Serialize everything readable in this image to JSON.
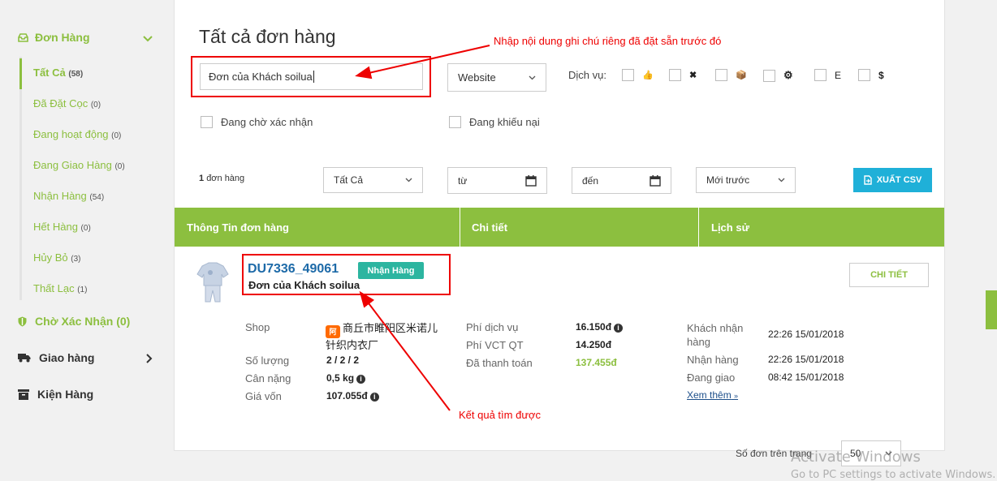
{
  "sidebar": {
    "header": "Đơn Hàng",
    "items": [
      {
        "label": "Tất Cả",
        "count": "(58)"
      },
      {
        "label": "Đã Đặt Cọc",
        "count": "(0)"
      },
      {
        "label": "Đang hoạt động",
        "count": "(0)"
      },
      {
        "label": "Đang Giao Hàng",
        "count": "(0)"
      },
      {
        "label": "Nhận Hàng",
        "count": "(54)"
      },
      {
        "label": "Hết Hàng",
        "count": "(0)"
      },
      {
        "label": "Hủy Bỏ",
        "count": "(3)"
      },
      {
        "label": "Thất Lạc",
        "count": "(1)"
      }
    ],
    "pending": "Chờ Xác Nhận (0)",
    "delivery": "Giao hàng",
    "packages": "Kiện Hàng"
  },
  "main": {
    "title": "Tất cả đơn hàng",
    "search_value": "Đơn của Khách soilua",
    "website_select": "Website",
    "services_label": "Dịch vụ:",
    "service_glyphs": [
      "👍",
      "✖",
      "📦",
      "⚙",
      "E",
      "$"
    ],
    "checkbox_pending": "Đang chờ xác nhận",
    "checkbox_complaint": "Đang khiếu nại",
    "order_count_num": "1",
    "order_count_text": "đơn hàng",
    "status_select": "Tất Cả",
    "from_placeholder": "từ",
    "to_placeholder": "đến",
    "sort_select": "Mới trước",
    "csv_button": "XUẤT CSV",
    "table_headers": [
      "Thông Tin đơn hàng",
      "Chi tiết",
      "Lịch sử"
    ]
  },
  "order": {
    "code": "DU7336_49061",
    "status": "Nhận Hàng",
    "note": "Đơn của Khách soilua",
    "detail_button": "CHI TIẾT",
    "shop_label": "Shop",
    "shop_name": "商丘市睢阳区米诺儿针织内衣厂",
    "qty_label": "Số lượng",
    "qty_value": "2 / 2 / 2",
    "weight_label": "Cân nặng",
    "weight_value": "0,5 kg",
    "cost_label": "Giá vốn",
    "cost_value": "107.055đ",
    "service_fee_label": "Phí dịch vụ",
    "service_fee_value": "16.150đ",
    "shipping_label": "Phí VCT QT",
    "shipping_value": "14.250đ",
    "paid_label": "Đã thanh toán",
    "paid_value": "137.455đ",
    "history": [
      {
        "label": "Khách nhận hàng",
        "time": "22:26 15/01/2018"
      },
      {
        "label": "Nhận hàng",
        "time": "22:26 15/01/2018"
      },
      {
        "label": "Đang giao",
        "time": "08:42 15/01/2018"
      }
    ],
    "see_more": "Xem thêm"
  },
  "annotations": {
    "top": "Nhập nội dung ghi chú riêng đã đặt sẵn trước đó",
    "bottom": "Kết quả tìm được"
  },
  "pager": {
    "label": "Số đơn trên trang",
    "value": "50"
  },
  "watermark": {
    "line1": "Activate Windows",
    "line2": "Go to PC settings to activate Windows."
  },
  "colors": {
    "accent_green": "#8cbf3f",
    "teal_badge": "#2cb5a0",
    "csv_blue": "#1fb0d8",
    "annotation_red": "#e00000",
    "link_blue": "#1d6aa8"
  }
}
